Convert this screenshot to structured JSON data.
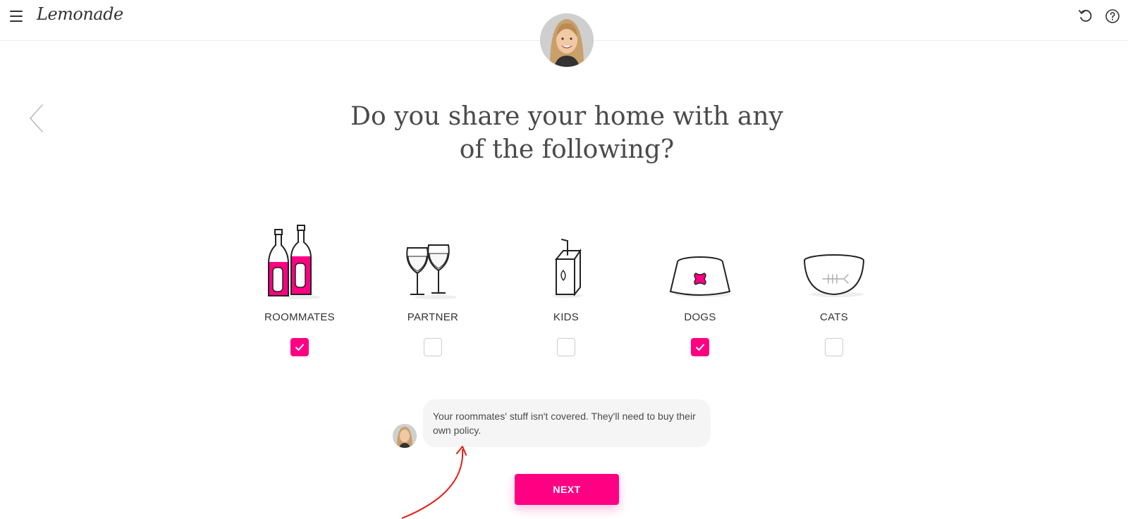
{
  "app": {
    "brand": "Lemonade"
  },
  "header": {
    "menu_icon": "hamburger-icon",
    "undo_icon": "undo-icon",
    "help_icon": "help-icon"
  },
  "question": {
    "line1": "Do you share your home with any",
    "line2": "of the following?"
  },
  "options": [
    {
      "label": "ROOMMATES",
      "icon": "bottles-icon",
      "checked": true
    },
    {
      "label": "PARTNER",
      "icon": "wine-glasses-icon",
      "checked": false
    },
    {
      "label": "KIDS",
      "icon": "juice-box-icon",
      "checked": false
    },
    {
      "label": "DOGS",
      "icon": "dog-bowl-icon",
      "checked": true
    },
    {
      "label": "CATS",
      "icon": "cat-bowl-icon",
      "checked": false
    }
  ],
  "message": {
    "text": "Your roommates' stuff isn't covered. They'll need to buy their own policy."
  },
  "next_button": {
    "label": "NEXT"
  },
  "colors": {
    "accent": "#ff0083",
    "text": "#4a4a4a",
    "annotation": "#e0201a"
  }
}
